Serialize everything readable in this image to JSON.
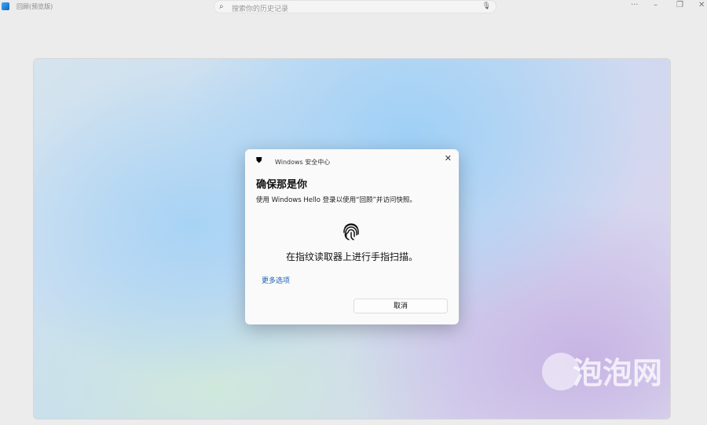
{
  "app": {
    "title": "回顾(预览版)",
    "search_placeholder": "搜索你的历史记录"
  },
  "window_controls": {
    "more": "···",
    "minimize": "–",
    "restore": "❐",
    "close": "✕"
  },
  "dialog": {
    "source": "Windows 安全中心",
    "heading": "确保那是你",
    "subtitle": "使用 Windows Hello 登录以使用“回顾”并访问快照。",
    "instruction": "在指纹读取器上进行手指扫描。",
    "more_options": "更多选项",
    "cancel": "取消"
  },
  "watermark": "泡泡网"
}
